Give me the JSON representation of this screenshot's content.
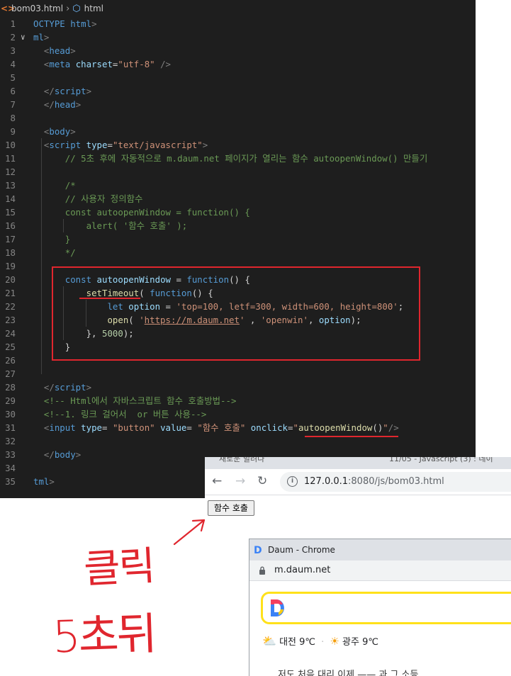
{
  "editor": {
    "breadcrumb": {
      "file": "bom03.html",
      "element": "html"
    },
    "lines": [
      {
        "n": "1",
        "tokens": [
          [
            "g",
            "OCTYPE "
          ],
          [
            "g",
            "html"
          ],
          [
            "t",
            ">"
          ]
        ]
      },
      {
        "n": "2",
        "fold": "∨",
        "tokens": [
          [
            "g",
            "ml"
          ],
          [
            "t",
            ">"
          ]
        ]
      },
      {
        "n": "3",
        "tokens": [
          [
            "w",
            "  "
          ],
          [
            "t",
            "<"
          ],
          [
            "g",
            "head"
          ],
          [
            "t",
            ">"
          ]
        ]
      },
      {
        "n": "4",
        "tokens": [
          [
            "w",
            "  "
          ],
          [
            "t",
            "<"
          ],
          [
            "g",
            "meta"
          ],
          [
            "w",
            " "
          ],
          [
            "a",
            "charset"
          ],
          [
            "w",
            "="
          ],
          [
            "s",
            "\"utf-8\""
          ],
          [
            "w",
            " "
          ],
          [
            "t",
            "/>"
          ]
        ]
      },
      {
        "n": "5",
        "tokens": []
      },
      {
        "n": "6",
        "tokens": [
          [
            "w",
            "  "
          ],
          [
            "t",
            "</"
          ],
          [
            "g",
            "script"
          ],
          [
            "t",
            ">"
          ]
        ]
      },
      {
        "n": "7",
        "tokens": [
          [
            "w",
            "  "
          ],
          [
            "t",
            "</"
          ],
          [
            "g",
            "head"
          ],
          [
            "t",
            ">"
          ]
        ]
      },
      {
        "n": "8",
        "tokens": []
      },
      {
        "n": "9",
        "tokens": [
          [
            "w",
            "  "
          ],
          [
            "t",
            "<"
          ],
          [
            "g",
            "body"
          ],
          [
            "t",
            ">"
          ]
        ]
      },
      {
        "n": "10",
        "tokens": [
          [
            "w",
            "  "
          ],
          [
            "t",
            "<"
          ],
          [
            "g",
            "script"
          ],
          [
            "w",
            " "
          ],
          [
            "a",
            "type"
          ],
          [
            "w",
            "="
          ],
          [
            "s",
            "\"text/javascript\""
          ],
          [
            "t",
            ">"
          ]
        ]
      },
      {
        "n": "11",
        "tokens": [
          [
            "w",
            "      "
          ],
          [
            "c",
            "// 5초 후에 자동적으로 m.daum.net 페이지가 열리는 함수 autoopenWindow() 만들기"
          ]
        ]
      },
      {
        "n": "12",
        "tokens": []
      },
      {
        "n": "13",
        "tokens": [
          [
            "w",
            "      "
          ],
          [
            "c",
            "/*"
          ]
        ]
      },
      {
        "n": "14",
        "tokens": [
          [
            "w",
            "      "
          ],
          [
            "c",
            "// 사용자 정의함수"
          ]
        ]
      },
      {
        "n": "15",
        "tokens": [
          [
            "w",
            "      "
          ],
          [
            "c",
            "const autoopenWindow = function() {"
          ]
        ]
      },
      {
        "n": "16",
        "tokens": [
          [
            "w",
            "          "
          ],
          [
            "c",
            "alert( '함수 호출' );"
          ]
        ]
      },
      {
        "n": "17",
        "tokens": [
          [
            "w",
            "      "
          ],
          [
            "c",
            "}"
          ]
        ]
      },
      {
        "n": "18",
        "tokens": [
          [
            "w",
            "      "
          ],
          [
            "c",
            "*/"
          ]
        ]
      },
      {
        "n": "19",
        "tokens": []
      },
      {
        "n": "20",
        "tokens": [
          [
            "w",
            "      "
          ],
          [
            "g",
            "const"
          ],
          [
            "w",
            " "
          ],
          [
            "a",
            "autoopenWindow"
          ],
          [
            "w",
            " = "
          ],
          [
            "g",
            "function"
          ],
          [
            "w",
            "() {"
          ]
        ]
      },
      {
        "n": "21",
        "tokens": [
          [
            "w",
            "          "
          ],
          [
            "f",
            "setTimeout"
          ],
          [
            "w",
            "( "
          ],
          [
            "g",
            "function"
          ],
          [
            "w",
            "() {"
          ]
        ]
      },
      {
        "n": "22",
        "tokens": [
          [
            "w",
            "              "
          ],
          [
            "g",
            "let"
          ],
          [
            "w",
            " "
          ],
          [
            "a",
            "option"
          ],
          [
            "w",
            " = "
          ],
          [
            "s",
            "'top=100, letf=300, width=600, height=800'"
          ],
          [
            "w",
            ";"
          ]
        ]
      },
      {
        "n": "23",
        "tokens": [
          [
            "w",
            "              "
          ],
          [
            "f",
            "open"
          ],
          [
            "w",
            "( "
          ],
          [
            "s",
            "'"
          ],
          [
            "su",
            "https://m.daum.net"
          ],
          [
            "s",
            "'"
          ],
          [
            "w",
            " , "
          ],
          [
            "s",
            "'openwin'"
          ],
          [
            "w",
            ", "
          ],
          [
            "a",
            "option"
          ],
          [
            "w",
            ");"
          ]
        ]
      },
      {
        "n": "24",
        "tokens": [
          [
            "w",
            "          }, "
          ],
          [
            "n",
            "5000"
          ],
          [
            "w",
            ");"
          ]
        ]
      },
      {
        "n": "25",
        "tokens": [
          [
            "w",
            "      }"
          ]
        ]
      },
      {
        "n": "26",
        "tokens": []
      },
      {
        "n": "27",
        "tokens": []
      },
      {
        "n": "28",
        "tokens": [
          [
            "w",
            "  "
          ],
          [
            "t",
            "</"
          ],
          [
            "g",
            "script"
          ],
          [
            "t",
            ">"
          ]
        ]
      },
      {
        "n": "29",
        "tokens": [
          [
            "w",
            "  "
          ],
          [
            "c",
            "<!-- Html에서 자바스크립트 함수 호출방법-->"
          ]
        ]
      },
      {
        "n": "30",
        "tokens": [
          [
            "w",
            "  "
          ],
          [
            "c",
            "<!--1. 링크 걸어서  or 버튼 사용-->"
          ]
        ]
      },
      {
        "n": "31",
        "tokens": [
          [
            "w",
            "  "
          ],
          [
            "t",
            "<"
          ],
          [
            "g",
            "input"
          ],
          [
            "w",
            " "
          ],
          [
            "a",
            "type"
          ],
          [
            "w",
            "= "
          ],
          [
            "s",
            "\"button\""
          ],
          [
            "w",
            " "
          ],
          [
            "a",
            "value"
          ],
          [
            "w",
            "= "
          ],
          [
            "s",
            "\"함수 호출\""
          ],
          [
            "w",
            " "
          ],
          [
            "a",
            "onclick"
          ],
          [
            "w",
            "="
          ],
          [
            "s",
            "\""
          ],
          [
            "f",
            "autoopenWindow"
          ],
          [
            "w",
            "()"
          ],
          [
            "s",
            "\""
          ],
          [
            "t",
            "/>"
          ]
        ]
      },
      {
        "n": "32",
        "tokens": []
      },
      {
        "n": "33",
        "tokens": [
          [
            "w",
            "  "
          ],
          [
            "t",
            "</"
          ],
          [
            "g",
            "body"
          ],
          [
            "t",
            ">"
          ]
        ]
      },
      {
        "n": "34",
        "tokens": []
      },
      {
        "n": "35",
        "tokens": [
          [
            "g",
            "tml"
          ],
          [
            "t",
            ">"
          ]
        ]
      }
    ]
  },
  "browser": {
    "tab_fragment_1": "새로운 밀려나",
    "tab_fragment_2": "11/05 - Javascript (3) : 네이",
    "url_host": "127.0.0.1",
    "url_rest": ":8080/js/bom03.html",
    "page_button_label": "함수 호출"
  },
  "popup": {
    "title": "Daum - Chrome",
    "address": "m.daum.net",
    "weather_city_1": "대전 9℃",
    "weather_city_2": "광주 9℃",
    "bottom_text": "저도 처음 대리 이제 —— 과 그 소등"
  },
  "annotations": {
    "click_note": "클릭",
    "delay_note": "5초뒤",
    "annotation_color": "#e0262e"
  },
  "colors": {
    "editor_bg": "#1e1e1e",
    "highlight_box": "#e0262e",
    "daum_search_border": "#ffe11a"
  }
}
